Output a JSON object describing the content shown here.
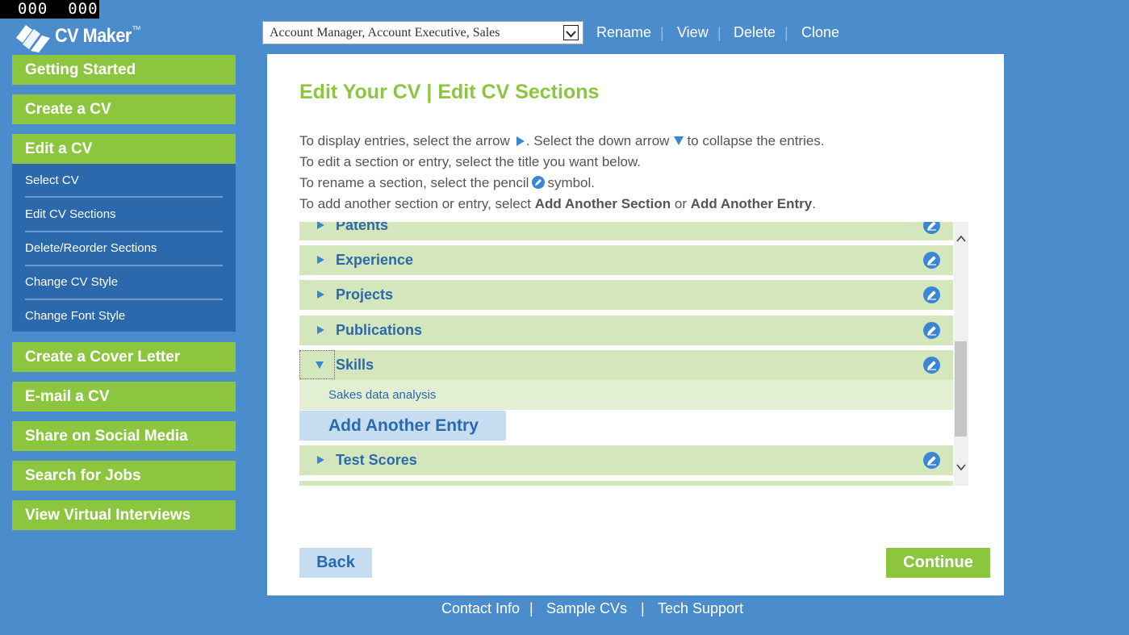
{
  "counter": "000  000",
  "logo": {
    "text": "CV Maker",
    "tm": "TM"
  },
  "nav": {
    "getting_started": "Getting Started",
    "create_cv": "Create a CV",
    "edit_cv": "Edit a CV",
    "sub_items": [
      "Select CV",
      "Edit CV Sections",
      "Delete/Reorder Sections",
      "Change CV Style",
      "Change Font Style"
    ],
    "cover_letter": "Create a Cover Letter",
    "email_cv": "E-mail a CV",
    "share": "Share on Social Media",
    "search_jobs": "Search for Jobs",
    "interviews": "View Virtual Interviews"
  },
  "toolbar": {
    "selected_cv": "Account Manager, Account Executive, Sales",
    "rename": "Rename",
    "view": "View",
    "delete": "Delete",
    "clone": "Clone",
    "separator": "|"
  },
  "main": {
    "title": "Edit Your CV | Edit CV Sections",
    "line1a": "To display entries, select the arrow",
    "line1b": ". Select the down arrow",
    "line1c": "to collapse the entries.",
    "line2": "To edit a section or entry, select the title you want below.",
    "line3a": "To rename a section, select the pencil",
    "line3b": "symbol.",
    "line4a": "To add another section or entry, select",
    "line4b": "Add Another Section",
    "line4c": "or",
    "line4d": "Add Another Entry",
    "line4e": "."
  },
  "sections": {
    "patents": "Patents",
    "experience": "Experience",
    "projects": "Projects",
    "publications": "Publications",
    "skills": "Skills",
    "skills_entry": "Sakes data analysis",
    "add_entry": "Add Another Entry",
    "test_scores": "Test Scores"
  },
  "buttons": {
    "back": "Back",
    "continue": "Continue"
  },
  "footer": {
    "contact": "Contact Info",
    "samples": "Sample CVs",
    "support": "Tech Support",
    "separator": "|"
  },
  "colors": {
    "accent_green": "#8cc63f",
    "nav_blue": "#2b69ac",
    "background_blue": "#4a8ccc",
    "row_green": "#d4e6bb"
  }
}
